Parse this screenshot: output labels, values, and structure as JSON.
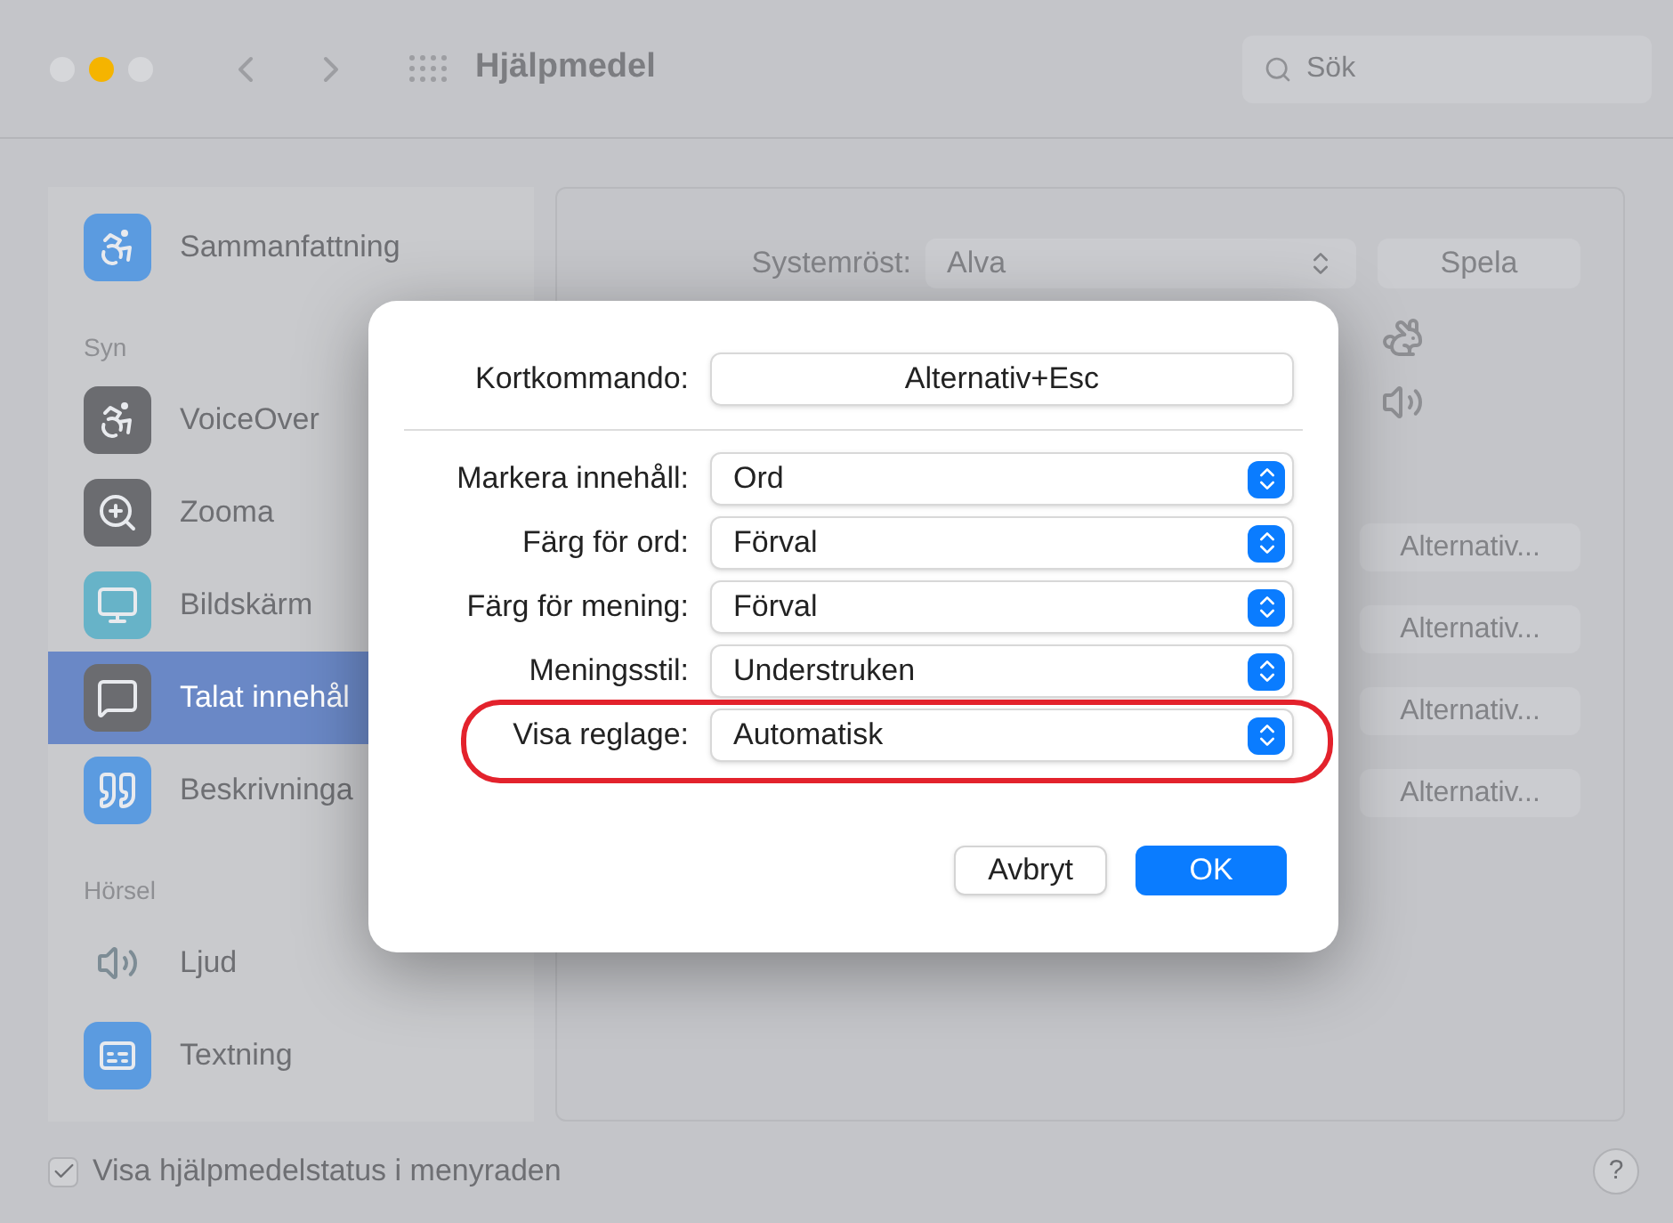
{
  "window": {
    "title": "Hjälpmedel",
    "search": {
      "placeholder": "Sök"
    }
  },
  "sidebar": {
    "items": [
      {
        "kind": "item",
        "label": "Sammanfattning",
        "selected": false
      },
      {
        "kind": "section",
        "label": "Syn"
      },
      {
        "kind": "item",
        "label": "VoiceOver",
        "selected": false
      },
      {
        "kind": "item",
        "label": "Zooma",
        "selected": false
      },
      {
        "kind": "item",
        "label": "Bildskärm",
        "selected": false
      },
      {
        "kind": "item",
        "label": "Talat innehål",
        "selected": true
      },
      {
        "kind": "item",
        "label": "Beskrivninga",
        "selected": false
      },
      {
        "kind": "section",
        "label": "Hörsel"
      },
      {
        "kind": "item",
        "label": "Ljud",
        "selected": false
      },
      {
        "kind": "item",
        "label": "Textning",
        "selected": false
      }
    ]
  },
  "panel": {
    "voice_label": "Systemröst:",
    "voice_value": "Alva",
    "play_button": "Spela",
    "option_buttons": [
      "Alternativ...",
      "Alternativ...",
      "Alternativ...",
      "Alternativ..."
    ]
  },
  "dialog": {
    "shortcut": {
      "label": "Kortkommando:",
      "value": "Alternativ+Esc"
    },
    "popups": [
      {
        "label": "Markera innehåll:",
        "value": "Ord",
        "highlighted": false
      },
      {
        "label": "Färg för ord:",
        "value": "Förval",
        "highlighted": false
      },
      {
        "label": "Färg för mening:",
        "value": "Förval",
        "highlighted": false
      },
      {
        "label": "Meningsstil:",
        "value": "Understruken",
        "highlighted": false
      },
      {
        "label": "Visa reglage:",
        "value": "Automatisk",
        "highlighted": true
      }
    ],
    "cancel_button": "Avbryt",
    "ok_button": "OK"
  },
  "footer": {
    "checkbox": {
      "label": "Visa hjälpmedelstatus i menyraden",
      "checked": true
    },
    "help_button": "?"
  }
}
